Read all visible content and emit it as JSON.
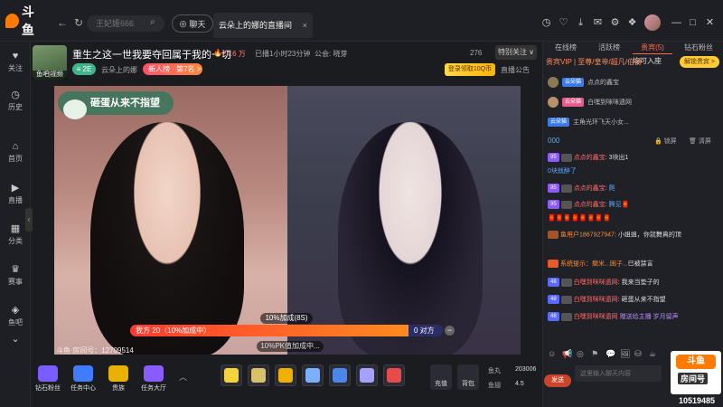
{
  "topbar": {
    "logo_text": "斗鱼",
    "search_placeholder": "王妃姬666",
    "chat_label": "聊天",
    "room_tab_title": "云朵上的娜的直播间",
    "room_tab_close": "×"
  },
  "sidebar": {
    "items": [
      {
        "label": "关注",
        "icon": "heart-icon"
      },
      {
        "label": "历史",
        "icon": "clock-icon"
      },
      {
        "label": "首页",
        "icon": "home-icon"
      },
      {
        "label": "直播",
        "icon": "play-icon"
      },
      {
        "label": "分类",
        "icon": "grid-icon"
      },
      {
        "label": "赛事",
        "icon": "trophy-icon"
      },
      {
        "label": "鱼吧",
        "icon": "fish-icon"
      }
    ]
  },
  "streamer": {
    "avatar_caption": "鱼吧|视频",
    "title": "重生之这一世我要夺回属于我的一切",
    "hot_value": "24.6 万",
    "duration": "已播1小时23分钟",
    "guild": "公会: 晓芽",
    "fans_count": "276",
    "follow_label": "特别关注 ∨",
    "level_badge": "≡ 2E",
    "room_name": "云朵上的娜",
    "rank_badge": "新人榜 · 第7名 >",
    "login_gift": "登录领取10Q币",
    "announcement": "直播公告"
  },
  "video": {
    "caption": "砸蛋从来不指望",
    "pk_left": "我方 20（10%加成中）",
    "pk_right": "0 对方",
    "pk_top_label": "10%加成(8S)",
    "pk_bottom_label": "10%PK值加成中...",
    "pk_progress": 0.89,
    "room_id_text": "斗鱼 房间号：12709514"
  },
  "toolbar": {
    "tools": [
      {
        "label": "钻石粉丝",
        "color": "#7b5cff"
      },
      {
        "label": "任务中心",
        "color": "#3f7cff"
      },
      {
        "label": "贵族",
        "color": "#e8b100"
      },
      {
        "label": "任务大厅",
        "color": "#8a5cff"
      }
    ],
    "gift_colors": [
      "#f3d23a",
      "#d9c06a",
      "#f0b000",
      "#7ab0ff",
      "#4b86e8",
      "#a6a0ff",
      "#e84a4a"
    ],
    "recharge_label": "充值",
    "backpack_label": "背包",
    "balance1_label": "鱼丸",
    "balance1_value": "203006",
    "balance2_label": "鱼翅",
    "balance2_value": "4.5"
  },
  "right_panel": {
    "tabs": [
      "在线榜",
      "活跃榜",
      "贵宾(5)",
      "钻石粉丝"
    ],
    "vip_line": "贵宾VIP | 至尊/皇帝/超凡/伯爵",
    "vip_join": "均可入座",
    "vip_btn": "解锁贵宾 >",
    "vip_rows": [
      {
        "tag": "云朵猫",
        "name": "点点的鑫宝"
      },
      {
        "tag": "云朵猫",
        "name": "白嘿到咪咪遗网"
      },
      {
        "tag": "云朵猫",
        "name": "主角光环飞天小女..."
      }
    ],
    "chat_tools_left": "000",
    "chat_tools_lock": "锁屏",
    "chat_tools_clear": "清屏",
    "messages": [
      {
        "tag": "95",
        "nick": "点点的鑫宝",
        "text": "3块出1"
      },
      {
        "tag": "",
        "nick": "",
        "text": "0块就醉了"
      },
      {
        "tag": "95",
        "nick": "点点的鑫宝",
        "text": "爬"
      },
      {
        "tag": "95",
        "nick": "点点的鑫宝",
        "text": "腾见🧧"
      },
      {
        "tag": "",
        "nick": "",
        "text": "🧧🧧🧧🧧🧧🧧🧧🧧"
      },
      {
        "tag": "",
        "nick": "鱼用户1867927947",
        "text": "小姐姐，你就舞真的顶"
      },
      {
        "tag": "",
        "nick": "系统提示：瘸米...困子...",
        "text": "已被禁言"
      },
      {
        "tag": "48",
        "nick": "白嘿到咪咪遗网",
        "text": "我来当垫子的"
      },
      {
        "tag": "48",
        "nick": "白嘿到咪咪遗网",
        "text": "砸蛋从来不指望"
      },
      {
        "tag": "48",
        "nick": "白嘿到咪咪遗网",
        "text": "赠送给主播 岁月留声"
      }
    ],
    "input_placeholder": "这里输入聊天内容",
    "send_label": "发送",
    "watermark_logo": "斗鱼",
    "watermark_room": "房间号",
    "viewer_count": "10519485"
  }
}
